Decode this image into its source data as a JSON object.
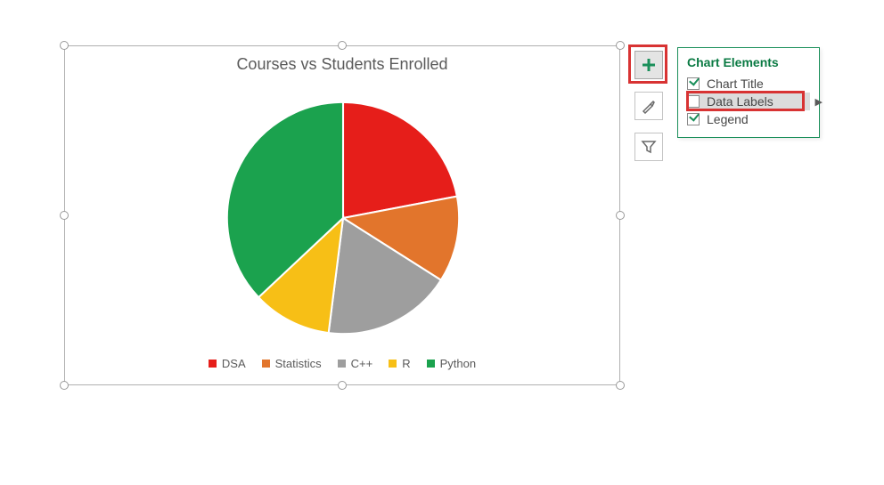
{
  "chart_data": {
    "type": "pie",
    "title": "Courses vs Students Enrolled",
    "series": [
      {
        "name": "DSA",
        "value": 22,
        "color": "#e61e1a"
      },
      {
        "name": "Statistics",
        "value": 12,
        "color": "#e2752c"
      },
      {
        "name": "C++",
        "value": 18,
        "color": "#9e9e9e"
      },
      {
        "name": "R",
        "value": 11,
        "color": "#f7bf16"
      },
      {
        "name": "Python",
        "value": 37,
        "color": "#1ba24e"
      }
    ]
  },
  "flyout": {
    "title": "Chart Elements",
    "items": [
      {
        "label": "Chart Title",
        "checked": true,
        "highlighted": false
      },
      {
        "label": "Data Labels",
        "checked": false,
        "highlighted": true,
        "has_submenu": true
      },
      {
        "label": "Legend",
        "checked": true,
        "highlighted": false
      }
    ]
  },
  "side_buttons": {
    "plus": "chart-elements",
    "brush": "chart-styles",
    "funnel": "chart-filters"
  }
}
